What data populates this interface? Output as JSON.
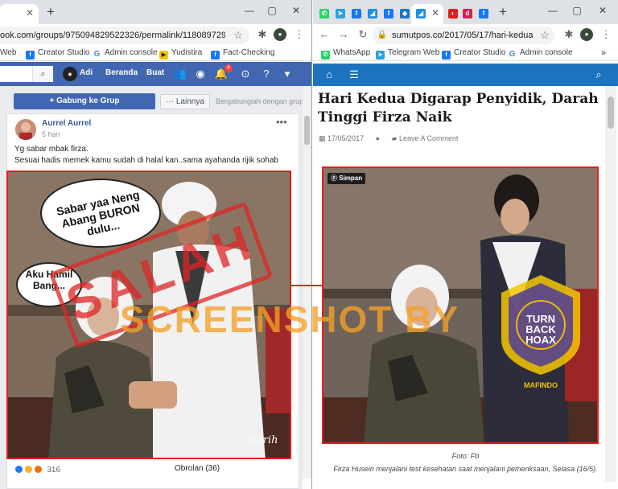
{
  "left_window": {
    "address": "ook.com/groups/975094829522326/permalink/1180897295608...",
    "bookmarks": [
      "Web",
      "Creator Studio",
      "Admin console",
      "Yudistira",
      "Fact-Checking"
    ],
    "fb": {
      "user": "Adi",
      "nav": [
        "Beranda",
        "Buat"
      ],
      "notification_count": "4",
      "join_button": "+ Gabung ke Grup",
      "more_button": "··· Lainnya",
      "join_hint": "Bergabunglah dengan grup i",
      "post": {
        "author": "Aurrel Aurrel",
        "time": "5 hari",
        "line1": "Yg sabar mbak firza.",
        "line2": "Sesuai hadis memek kamu sudah di halal kan..sama ayahanda rijik sohab"
      },
      "meme": {
        "bubble1": "Sabar yaa Neng Abang BURON dulu...",
        "bubble2": "Aku Hamil Bang...",
        "signature": "Gurih",
        "stamp": "SALAH"
      },
      "reaction_count": "316",
      "comments": "Obrolan (36)"
    }
  },
  "right_window": {
    "address": "sumutpos.co/2017/05/17/hari-kedua-...",
    "bookmarks": [
      "WhatsApp",
      "Telegram Web",
      "Creator Studio",
      "Admin console"
    ],
    "article": {
      "title": "Hari Kedua Digarap Penyidik, Darah Tinggi Firza Naik",
      "date": "17/05/2017",
      "comment_link": "Leave A Comment",
      "pin_label": "Simpan",
      "credit": "Foto: Fb",
      "caption": "Firza Husein menjalani test kesehatan saat menjalani pemeriksaan, Selasa (16/5)."
    }
  },
  "overlay": {
    "watermark": "SCREENSHOT BY",
    "seal_lines": [
      "TURN",
      "BACK",
      "HOAX"
    ],
    "seal_org": "MAFINDO"
  },
  "colors": {
    "facebook_blue": "#4267b2",
    "site_blue": "#1e73be",
    "highlight_red": "#e0201b"
  }
}
